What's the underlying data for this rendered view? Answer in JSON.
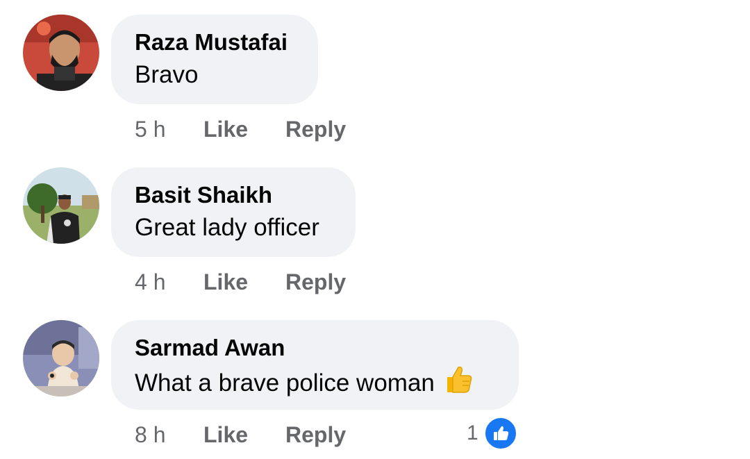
{
  "comments": [
    {
      "author": "Raza Mustafai",
      "text": "Bravo",
      "time": "5 h",
      "like_label": "Like",
      "reply_label": "Reply",
      "avatar_icon": "avatar-man-red-background"
    },
    {
      "author": "Basit Shaikh",
      "text": "Great lady officer",
      "time": "4 h",
      "like_label": "Like",
      "reply_label": "Reply",
      "avatar_icon": "avatar-man-outdoors"
    },
    {
      "author": "Sarmad Awan",
      "text": "What a brave police woman",
      "time": "8 h",
      "like_label": "Like",
      "reply_label": "Reply",
      "avatar_icon": "avatar-baby",
      "emoji": "thumbs-up-emoji",
      "reaction_count": "1",
      "reaction_icon": "like-reaction-icon"
    }
  ],
  "colors": {
    "bubble": "#f0f2f5",
    "author": "#050505",
    "meta": "#65676b",
    "like_blue": "#1877f2"
  }
}
